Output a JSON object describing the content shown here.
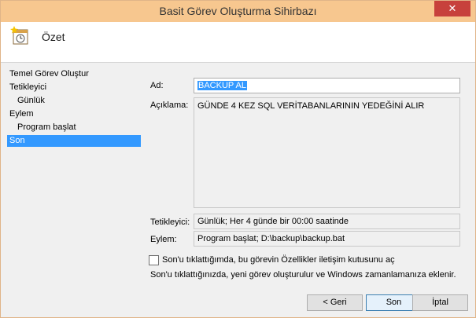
{
  "window": {
    "title": "Basit Görev Oluşturma Sihirbazı",
    "close_glyph": "✕"
  },
  "header": {
    "title": "Özet",
    "icon": "task-wizard-icon"
  },
  "sidebar": {
    "items": [
      {
        "label": "Temel Görev Oluştur"
      },
      {
        "label": "Tetikleyici"
      },
      {
        "label": "Günlük"
      },
      {
        "label": "Eylem"
      },
      {
        "label": "Program başlat"
      },
      {
        "label": "Son"
      }
    ]
  },
  "form": {
    "name_label": "Ad:",
    "name_value": "BACKUP AL",
    "desc_label": "Açıklama:",
    "desc_value": "GÜNDE 4 KEZ SQL VERİTABANLARININ YEDEĞİNİ ALIR",
    "trigger_label": "Tetikleyici:",
    "trigger_value": "Günlük; Her 4 günde bir 00:00 saatinde",
    "action_label": "Eylem:",
    "action_value": "Program başlat; D:\\backup\\backup.bat",
    "checkbox_label": "Son'u tıklattığımda, bu görevin Özellikler iletişim kutusunu aç",
    "info_text": "Son'u tıklattığınızda, yeni görev oluşturulur ve Windows zamanlamanıza eklenir."
  },
  "buttons": {
    "back": "< Geri",
    "finish": "Son",
    "cancel": "İptal"
  },
  "colors": {
    "titlebar": "#f7c78f",
    "close": "#c7413c",
    "selection": "#3399ff"
  }
}
